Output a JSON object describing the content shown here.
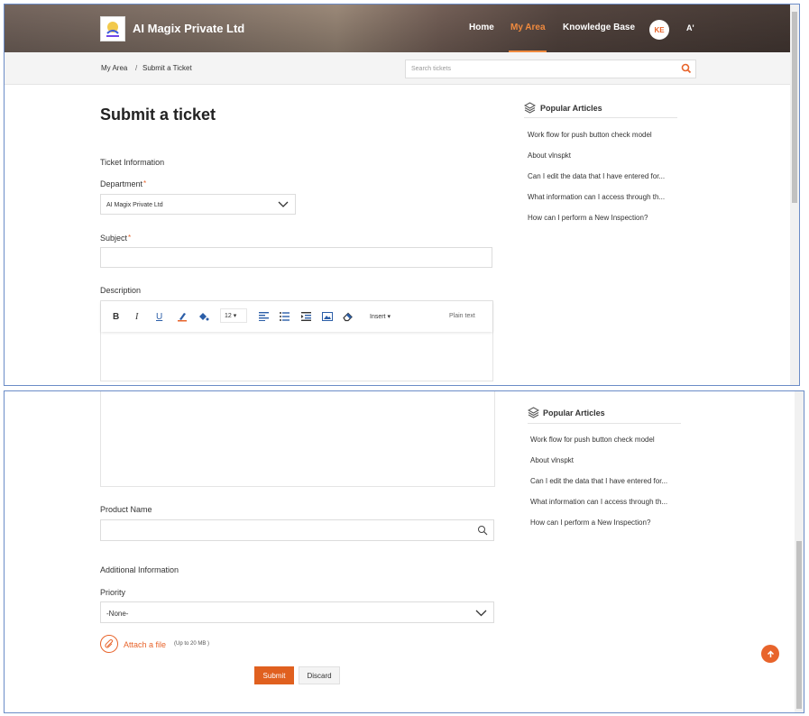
{
  "header": {
    "brand": "AI Magix Private Ltd",
    "nav": {
      "home": "Home",
      "my_area": "My Area",
      "knowledge_base": "Knowledge Base"
    },
    "avatar_initials": "KE",
    "font_toggle": "A'"
  },
  "breadcrumb": {
    "item1": "My Area",
    "separator": "/",
    "item2": "Submit a Ticket"
  },
  "search": {
    "placeholder": "Search tickets"
  },
  "form": {
    "title": "Submit a ticket",
    "ticket_info_heading": "Ticket Information",
    "department_label": "Department",
    "department_value": "AI Magix Private Ltd",
    "subject_label": "Subject",
    "description_label": "Description",
    "editor": {
      "font_size": "12",
      "insert_label": "Insert",
      "plain_text_label": "Plain text"
    },
    "product_name_label": "Product Name",
    "additional_info_heading": "Additional Information",
    "priority_label": "Priority",
    "priority_value": "-None-",
    "attach_label": "Attach a file",
    "attach_limit": "(Up to 20 MB )",
    "submit_label": "Submit",
    "discard_label": "Discard"
  },
  "popular_articles": {
    "title": "Popular Articles",
    "items": [
      "Work flow for push button check model",
      "About vlnspkt",
      "Can I edit the data that I have entered for...",
      "What information can I access through th...",
      "How can I perform a New Inspection?"
    ]
  },
  "colors": {
    "accent": "#e8642b",
    "nav_active": "#f08a3e",
    "submit": "#e0601f"
  }
}
